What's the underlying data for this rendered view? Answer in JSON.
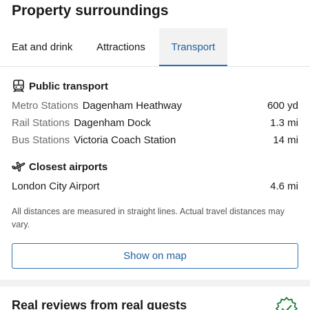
{
  "header": {
    "title": "Property surroundings"
  },
  "tabs": [
    {
      "label": "Eat and drink",
      "selected": false
    },
    {
      "label": "Attractions",
      "selected": false
    },
    {
      "label": "Transport",
      "selected": true
    }
  ],
  "public_transport": {
    "heading": "Public transport",
    "icon": "train-icon",
    "rows": [
      {
        "kind": "Metro Stations",
        "place": "Dagenham Heathway",
        "distance": "600 yd"
      },
      {
        "kind": "Rail Stations",
        "place": "Dagenham Dock",
        "distance": "1.3 mi"
      },
      {
        "kind": "Bus Stations",
        "place": "Victoria Coach Station",
        "distance": "14 mi"
      }
    ]
  },
  "airports": {
    "heading": "Closest airports",
    "icon": "airplane-icon",
    "rows": [
      {
        "place": "London City Airport",
        "distance": "4.6 mi"
      }
    ]
  },
  "note": "All distances are measured in straight lines. Actual travel distances may vary.",
  "show_map_label": "Show on map",
  "reviews": {
    "title": "Real reviews from real guests",
    "badge_icon": "verified-badge-icon"
  },
  "colors": {
    "accent": "#2b6fb3",
    "accent_text": "#1f5f9f",
    "muted_text": "#6b6b6b",
    "tab_selected_bg": "#f2f2f2",
    "badge_green": "#1f7a3a"
  }
}
